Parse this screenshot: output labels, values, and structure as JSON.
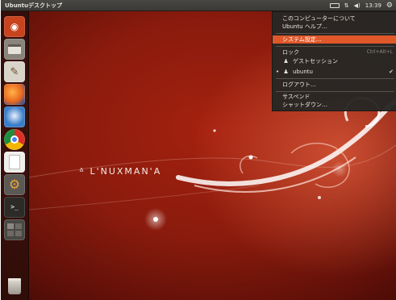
{
  "top_panel": {
    "title": "Ubuntuデスクトップ",
    "clock": "13:39",
    "indicators": [
      "keyboard-icon",
      "network-icon",
      "volume-icon",
      "session-gear-icon"
    ]
  },
  "launcher": {
    "items": [
      {
        "name": "dash-home-icon",
        "color": "#d4482a"
      },
      {
        "name": "file-manager-icon",
        "color": "#b8b2a8"
      },
      {
        "name": "text-editor-icon",
        "color": "#e6e1d6"
      },
      {
        "name": "firefox-icon",
        "color": "#e8661e"
      },
      {
        "name": "thunderbird-icon",
        "color": "#3a7dc9"
      },
      {
        "name": "chrome-icon",
        "color": "#3f9d3a"
      },
      {
        "name": "document-icon",
        "color": "#efeeea"
      },
      {
        "name": "system-settings-icon",
        "color": "#5a5955"
      },
      {
        "name": "terminal-icon",
        "color": "#3b3a36"
      },
      {
        "name": "workspace-switcher-icon",
        "color": "#4a4844"
      },
      {
        "name": "trash-icon",
        "color": "#c9c5bd"
      }
    ]
  },
  "wallpaper": {
    "logo_text": "ᐞ L'NUXMAN'A"
  },
  "session_menu": {
    "about": "このコンピューターについて",
    "help": "Ubuntu ヘルプ…",
    "system_settings": "システム設定…",
    "lock": "ロック",
    "lock_shortcut": "Ctrl+Alt+L",
    "guest_session": "ゲストセッション",
    "current_user": "ubuntu",
    "logout": "ログアウト…",
    "suspend": "サスペンド",
    "shutdown": "シャットダウン…"
  },
  "colors": {
    "highlight": "#e0582a",
    "panel": "#3c3b37"
  }
}
